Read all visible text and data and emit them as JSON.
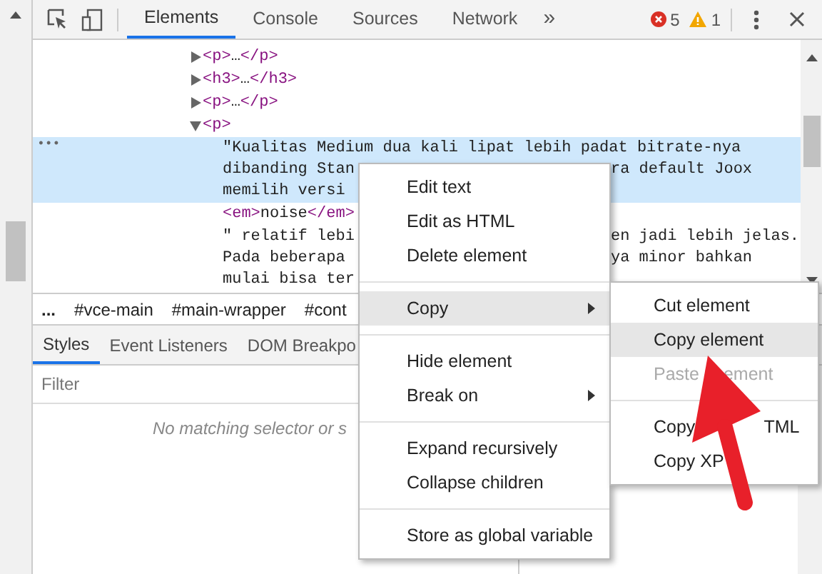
{
  "toolbar": {
    "tabs": [
      {
        "label": "Elements",
        "selected": true
      },
      {
        "label": "Console",
        "selected": false
      },
      {
        "label": "Sources",
        "selected": false
      },
      {
        "label": "Network",
        "selected": false
      }
    ],
    "more": "»",
    "errors": "5",
    "warnings": "1"
  },
  "tree": {
    "rows": [
      {
        "kind": "node",
        "expanded": false,
        "selected": false,
        "lines": [
          [
            "<p>…</p>"
          ]
        ]
      },
      {
        "kind": "node",
        "expanded": false,
        "selected": false,
        "lines": [
          [
            "<h3>…</h3>"
          ]
        ]
      },
      {
        "kind": "node",
        "expanded": false,
        "selected": false,
        "lines": [
          [
            "<p>…</p>"
          ]
        ]
      },
      {
        "kind": "node",
        "expanded": true,
        "selected": false,
        "lines": [
          [
            "<p>"
          ]
        ]
      },
      {
        "kind": "text",
        "selected": true,
        "marker": "•••",
        "lines": [
          [
            "\"Kualitas Medium dua kali lipat lebih padat bitrate-nya"
          ],
          [
            "dibanding Stan",
            "ra default Joox"
          ],
          [
            "memilih versi"
          ]
        ]
      },
      {
        "kind": "text",
        "selected": false,
        "lines": [
          [
            "<em>noise</em>"
          ]
        ]
      },
      {
        "kind": "text",
        "selected": false,
        "lines": [
          [
            "\" relatif lebi",
            "en jadi lebih jelas."
          ],
          [
            "Pada beberapa",
            "ya minor bahkan"
          ],
          [
            "mulai bisa ter"
          ]
        ]
      }
    ]
  },
  "breadcrumb": {
    "more": "...",
    "items": [
      "#vce-main",
      "#main-wrapper",
      "#cont"
    ]
  },
  "sidebar": {
    "tabs": [
      {
        "label": "Styles",
        "selected": true
      },
      {
        "label": "Event Listeners",
        "selected": false
      },
      {
        "label": "DOM Breakpo",
        "selected": false
      }
    ],
    "filter_placeholder": "Filter",
    "empty_text": "No matching selector or s"
  },
  "context_menu": {
    "groups": [
      [
        {
          "label": "Edit text",
          "highlighted": false,
          "submenu": false
        },
        {
          "label": "Edit as HTML",
          "highlighted": false,
          "submenu": false
        },
        {
          "label": "Delete element",
          "highlighted": false,
          "submenu": false
        }
      ],
      [
        {
          "label": "Copy",
          "highlighted": true,
          "submenu": true
        }
      ],
      [
        {
          "label": "Hide element",
          "highlighted": false,
          "submenu": false
        },
        {
          "label": "Break on",
          "highlighted": false,
          "submenu": true
        }
      ],
      [
        {
          "label": "Expand recursively",
          "highlighted": false,
          "submenu": false
        },
        {
          "label": "Collapse children",
          "highlighted": false,
          "submenu": false
        }
      ],
      [
        {
          "label": "Store as global variable",
          "highlighted": false,
          "submenu": false
        }
      ]
    ]
  },
  "submenu": {
    "groups": [
      [
        {
          "label": [
            "Cut element"
          ],
          "highlighted": false,
          "disabled": false
        },
        {
          "label": [
            "Copy element"
          ],
          "highlighted": true,
          "disabled": false
        },
        {
          "label": [
            "Paste",
            "ement"
          ],
          "highlighted": false,
          "disabled": true
        }
      ],
      [
        {
          "label": [
            "Copy",
            "TML"
          ],
          "highlighted": false,
          "disabled": false
        },
        {
          "label": [
            "Copy XP"
          ],
          "highlighted": false,
          "disabled": false
        }
      ]
    ]
  }
}
